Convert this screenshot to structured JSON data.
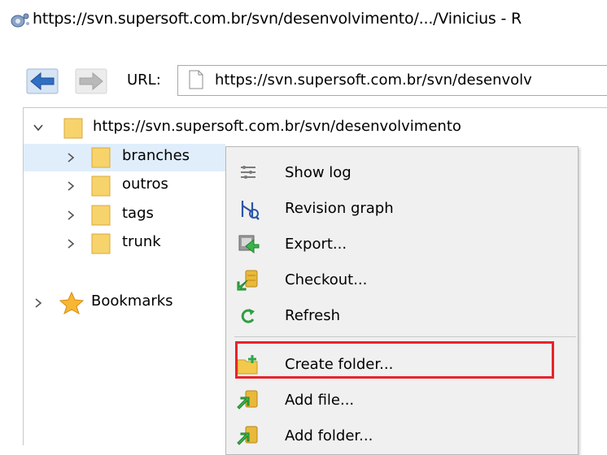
{
  "window": {
    "title": "https://svn.supersoft.com.br/svn/desenvolvimento/.../Vinicius - R"
  },
  "toolbar": {
    "url_label": "URL:",
    "url_value": "https://svn.supersoft.com.br/svn/desenvolv"
  },
  "tree": {
    "root": "https://svn.supersoft.com.br/svn/desenvolvimento",
    "children": [
      "branches",
      "outros",
      "tags",
      "trunk"
    ],
    "bookmarks": "Bookmarks"
  },
  "context_menu": {
    "items": [
      {
        "label": "Show log",
        "icon": "show-log-icon"
      },
      {
        "label": "Revision graph",
        "icon": "revision-graph-icon"
      },
      {
        "label": "Export...",
        "icon": "export-icon"
      },
      {
        "label": "Checkout...",
        "icon": "checkout-icon"
      },
      {
        "label": "Refresh",
        "icon": "refresh-icon"
      },
      {
        "label": "Create folder...",
        "icon": "create-folder-icon"
      },
      {
        "label": "Add file...",
        "icon": "add-file-icon"
      },
      {
        "label": "Add folder...",
        "icon": "add-folder-icon"
      }
    ]
  },
  "colors": {
    "selection": "#e0eefc",
    "highlight_border": "#e8232b",
    "folder": "#f7d36b"
  }
}
